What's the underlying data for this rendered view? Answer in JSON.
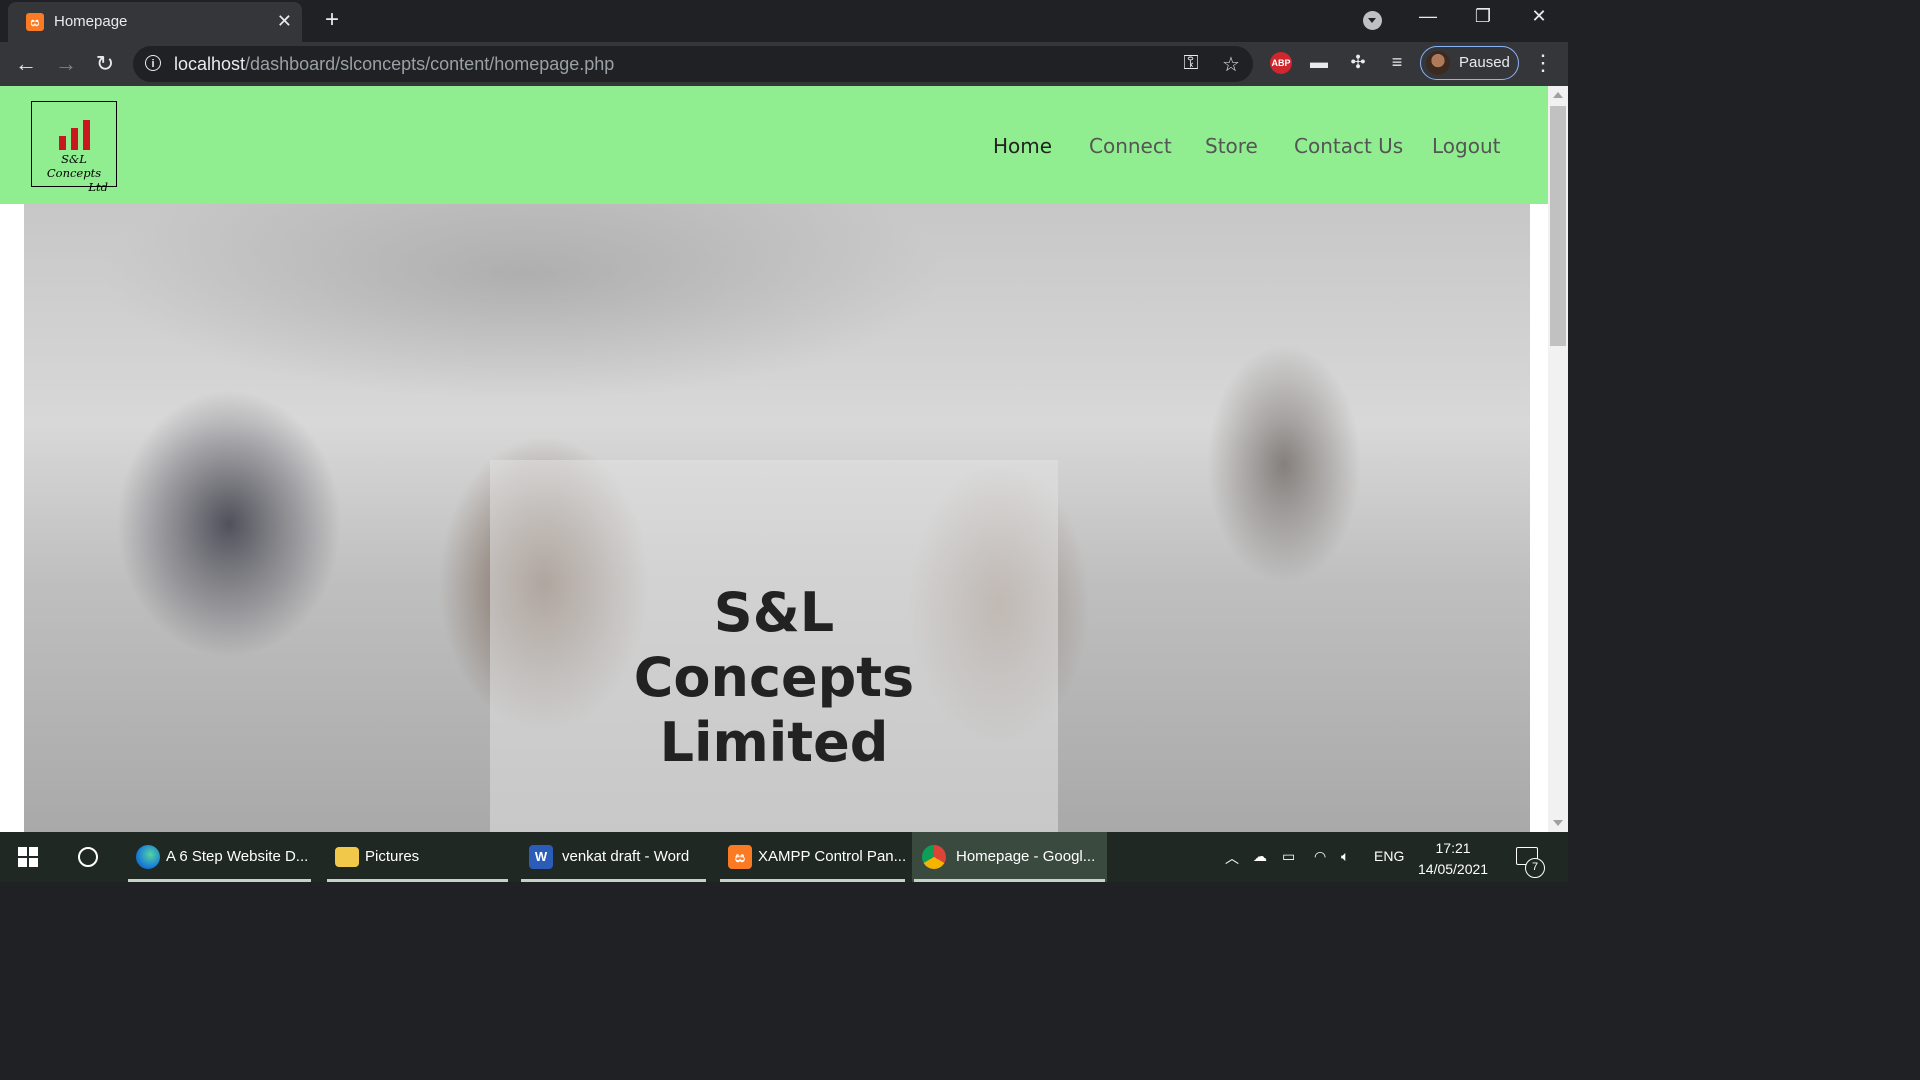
{
  "browser": {
    "tab": {
      "title": "Homepage",
      "favicon": "xampp-icon"
    },
    "url": {
      "host": "localhost",
      "path": "/dashboard/slconcepts/content/homepage.php"
    },
    "profile_label": "Paused",
    "abp_label": "ABP"
  },
  "site": {
    "logo": {
      "line1": "S&L Concepts",
      "line2": "Ltd"
    },
    "nav": [
      {
        "label": "Home",
        "active": true
      },
      {
        "label": "Connect",
        "active": false
      },
      {
        "label": "Store",
        "active": false
      },
      {
        "label": "Contact Us",
        "active": false
      },
      {
        "label": "Logout",
        "active": false
      }
    ],
    "hero": {
      "line1": "S&L",
      "line2": "Concepts",
      "line3": "Limited"
    },
    "colors": {
      "navbar": "#90ee90",
      "logo_bars": "#c8181e"
    }
  },
  "taskbar": {
    "items": [
      {
        "label": "A 6 Step Website D...",
        "icon": "edge-icon"
      },
      {
        "label": "Pictures",
        "icon": "folder-icon"
      },
      {
        "label": "venkat draft - Word",
        "icon": "word-icon"
      },
      {
        "label": "XAMPP Control Pan...",
        "icon": "xampp-icon"
      },
      {
        "label": "Homepage - Googl...",
        "icon": "chrome-icon"
      }
    ],
    "language": "ENG",
    "time": "17:21",
    "date": "14/05/2021",
    "notification_count": "7"
  }
}
